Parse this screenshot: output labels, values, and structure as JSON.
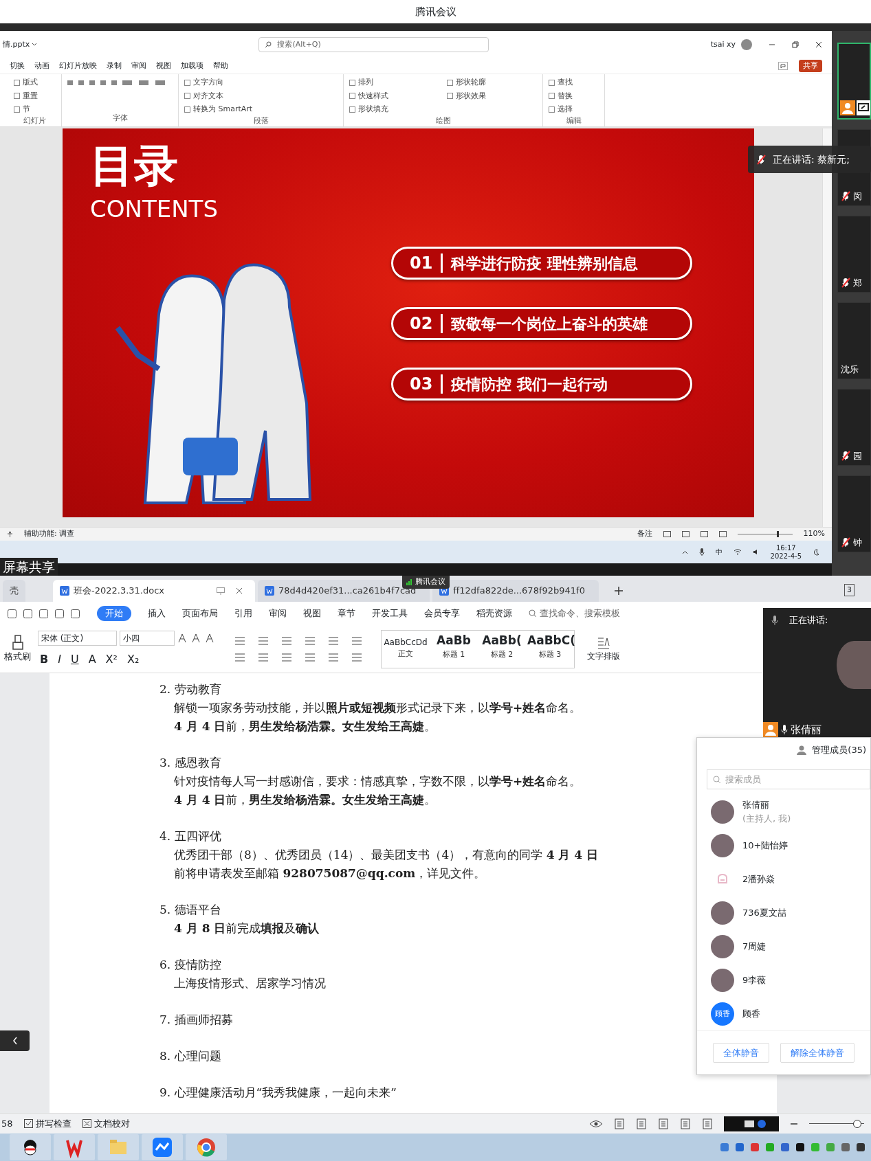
{
  "meeting_title": "腾讯会议",
  "ppt": {
    "file": "情.pptx",
    "search_placeholder": "搜索(Alt+Q)",
    "user": "tsai xy",
    "menu": [
      "切换",
      "动画",
      "幻灯片放映",
      "录制",
      "审阅",
      "视图",
      "加载项",
      "帮助"
    ],
    "share_button": "共享",
    "ribbon_groups": [
      {
        "label": "幻灯片",
        "items": [
          "版式",
          "重置",
          "节"
        ]
      },
      {
        "label": "字体"
      },
      {
        "label": "段落",
        "items": [
          "文字方向",
          "对齐文本",
          "转换为 SmartArt"
        ]
      },
      {
        "label": "绘图",
        "items": [
          "排列",
          "快速样式",
          "形状填充",
          "形状轮廓",
          "形状效果"
        ]
      },
      {
        "label": "编辑",
        "items": [
          "查找",
          "替换",
          "选择"
        ]
      }
    ],
    "slide": {
      "title": "目录",
      "subtitle": "CONTENTS",
      "items": [
        {
          "number": "01",
          "text": "科学进行防疫 理性辨别信息"
        },
        {
          "number": "02",
          "text": "致敬每一个岗位上奋斗的英雄"
        },
        {
          "number": "03",
          "text": "疫情防控 我们一起行动"
        }
      ]
    },
    "status_left": "辅助功能: 调查",
    "notes": "备注",
    "zoom": {
      "label": "110%",
      "level": 0.72
    }
  },
  "top_taskbar": {
    "ime": "中",
    "time": "16:17",
    "date": "2022-4-5"
  },
  "share_label": "屏幕共享",
  "speaking": "正在讲话: 蔡新元;",
  "rail_tiles": [
    {
      "name": "闵",
      "muted": true
    },
    {
      "name": "郑",
      "muted": true
    },
    {
      "name": "沈乐",
      "muted": false
    },
    {
      "name": "园",
      "muted": true
    },
    {
      "name": "钟",
      "muted": true
    }
  ],
  "wps": {
    "tabs": [
      {
        "label": "壳",
        "kind": "plain",
        "selected": false
      },
      {
        "label": "班会-2022.3.31.docx",
        "kind": "doc",
        "selected": true
      },
      {
        "label": "78d4d420ef31...ca261b4f7cad",
        "kind": "doc",
        "selected": false
      },
      {
        "label": "ff12dfa822de...678f92b941f0",
        "kind": "doc",
        "selected": false
      }
    ],
    "meeting_badge": "腾讯会议",
    "window_count": "3",
    "menu": [
      {
        "label": "开始",
        "selected": true
      },
      {
        "label": "插入",
        "selected": false
      },
      {
        "label": "页面布局",
        "selected": false
      },
      {
        "label": "引用",
        "selected": false
      },
      {
        "label": "审阅",
        "selected": false
      },
      {
        "label": "视图",
        "selected": false
      },
      {
        "label": "章节",
        "selected": false
      },
      {
        "label": "开发工具",
        "selected": false
      },
      {
        "label": "会员专享",
        "selected": false
      },
      {
        "label": "稻壳资源",
        "selected": false
      }
    ],
    "command_search": "查找命令、搜索模板",
    "format_painter": "格式刷",
    "font": "宋体 (正文)",
    "size": "小四",
    "format_buttons": [
      "B",
      "I",
      "U",
      "A",
      "X²",
      "X₂"
    ],
    "styles": [
      {
        "sample": "AaBbCcDd",
        "name": "正文"
      },
      {
        "sample": "AaBb",
        "name": "标题 1"
      },
      {
        "sample": "AaBb(",
        "name": "标题 2"
      },
      {
        "sample": "AaBbC(",
        "name": "标题 3"
      }
    ],
    "typeset": "文字排版",
    "document": [
      {
        "heading": "2. 劳动教育",
        "lines": [
          "解锁一项家务劳动技能，并以**照片或短视频**形式记录下来，以**学号+姓名**命名。",
          "**4 月 4 日**前，**男生发给杨浩霖。女生发给王高婕**。"
        ]
      },
      {
        "heading": "3. 感恩教育",
        "lines": [
          "针对疫情每人写一封感谢信，要求：情感真挚，字数不限，以**学号+姓名**命名。",
          "**4 月 4 日**前，**男生发给杨浩霖。女生发给王高婕**。"
        ]
      },
      {
        "heading": "4. 五四评优",
        "lines": [
          "优秀团干部（8）、优秀团员（14）、最美团支书（4），有意向的同学 **4 月 4 日**",
          "前将申请表发至邮箱 **928075087@qq.com**，详见文件。"
        ]
      },
      {
        "heading": "5. 德语平台",
        "lines": [
          " **4 月 8 日**前完成**填报**及**确认**"
        ]
      },
      {
        "heading": "6. 疫情防控",
        "lines": [
          "上海疫情形式、居家学习情况"
        ]
      },
      {
        "heading": "7. 插画师招募"
      },
      {
        "heading": "8. 心理问题"
      },
      {
        "heading": "9. 心理健康活动月“我秀我健康，一起向未来”"
      }
    ],
    "page": "58",
    "spell_check": "拼写检查",
    "proofread": "文档校对",
    "zoom": {
      "level": 0.95
    }
  },
  "mini_meeting": {
    "speaking": "正在讲话:",
    "name": "张倩丽"
  },
  "members": {
    "title": "管理成员(35)",
    "search_placeholder": "搜索成员",
    "list": [
      {
        "name": "张倩丽",
        "note": "(主持人, 我)",
        "kind": "photo"
      },
      {
        "name": "10+陆怡婷",
        "kind": "photo"
      },
      {
        "name": "2潘孙焱",
        "kind": "default"
      },
      {
        "name": "736夏文喆",
        "kind": "photo"
      },
      {
        "name": "7周婕",
        "kind": "photo"
      },
      {
        "name": "9李薇",
        "kind": "photo"
      },
      {
        "name": "顾香",
        "kind": "text",
        "avatar_text": "顾香"
      }
    ],
    "buttons": [
      "全体静音",
      "解除全体静音"
    ]
  },
  "taskbar_apps": [
    {
      "kind": "qq"
    },
    {
      "kind": "wps"
    },
    {
      "kind": "folder"
    },
    {
      "kind": "meeting"
    },
    {
      "kind": "chrome"
    }
  ]
}
